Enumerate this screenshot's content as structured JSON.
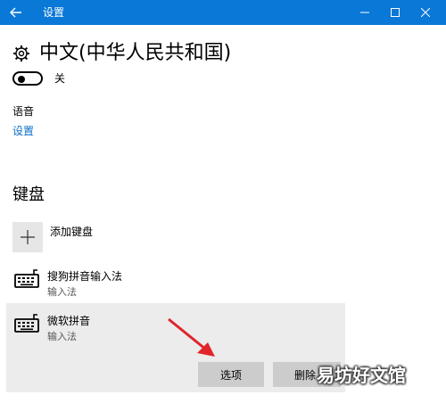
{
  "window": {
    "title": "设置",
    "back_icon": "arrow-left-icon",
    "controls": [
      "minimize-icon",
      "maximize-icon",
      "close-icon"
    ]
  },
  "header": {
    "icon": "gear-icon",
    "title": "中文(中华人民共和国)"
  },
  "toggle": {
    "state": "off",
    "label": "关"
  },
  "speech": {
    "label": "语音",
    "link": "设置"
  },
  "keyboards": {
    "heading": "键盘",
    "add_label": "添加键盘",
    "items": [
      {
        "name": "搜狗拼音输入法",
        "subtitle": "输入法",
        "icon": "keyboard-icon"
      },
      {
        "name": "微软拼音",
        "subtitle": "输入法",
        "icon": "keyboard-icon",
        "selected": true
      }
    ],
    "options_button": "选项",
    "remove_button": "删除"
  },
  "watermark": "易坊好文馆",
  "colors": {
    "titlebar": "#0a78d7",
    "link": "#0a6fc8",
    "arrow": "#e0262b"
  }
}
